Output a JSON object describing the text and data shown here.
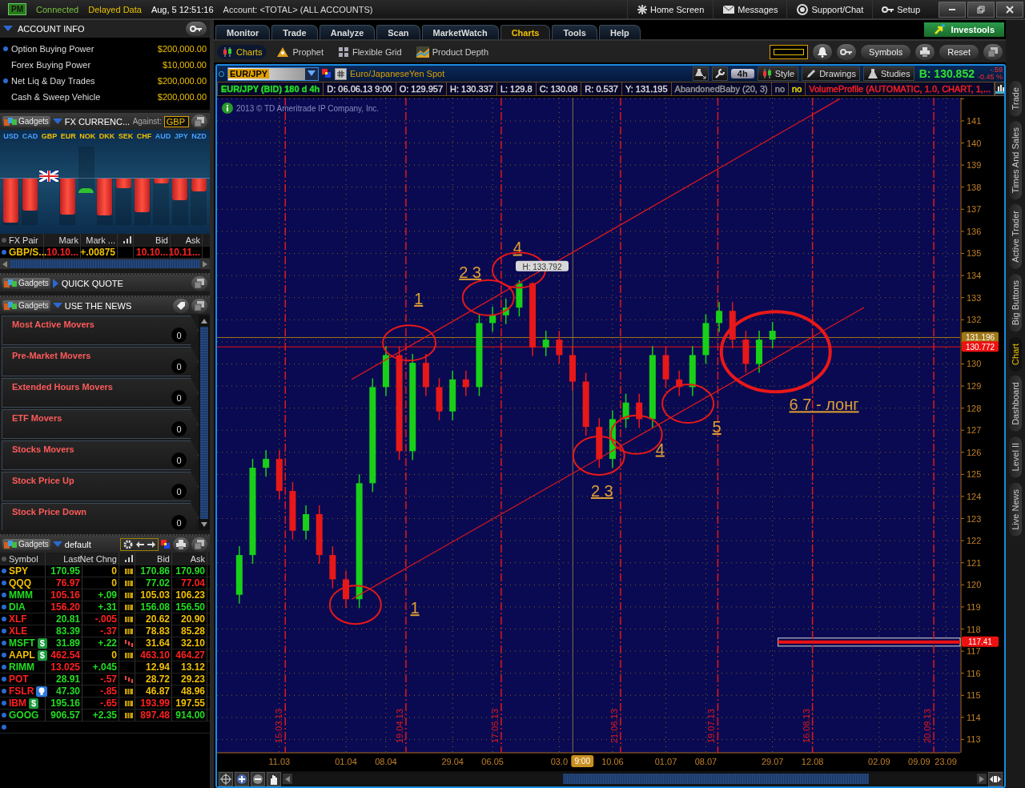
{
  "top_bar": {
    "badge": "PM",
    "status": "Connected",
    "data_mode": "Delayed Data",
    "datetime": "Aug, 5  12:51:16",
    "account": "Account: <TOTAL> (ALL ACCOUNTS)",
    "links": [
      "Home Screen",
      "Messages",
      "Support/Chat",
      "Setup"
    ]
  },
  "account_info": {
    "title": "ACCOUNT INFO",
    "rows": [
      {
        "label": "Option Buying Power",
        "value": "$200,000.00",
        "dot": true
      },
      {
        "label": "Forex Buying Power",
        "value": "$10,000.00",
        "dot": false
      },
      {
        "label": "Net Liq & Day Trades",
        "value": "$200,000.00",
        "dot": true
      },
      {
        "label": "Cash & Sweep Vehicle",
        "value": "$200,000.00",
        "dot": false
      }
    ]
  },
  "fx_gadget": {
    "gadgets": "Gadgets",
    "title": "FX CURRENC...",
    "against_label": "Against:",
    "against": "GBP",
    "currencies": [
      {
        "code": "USD",
        "color": "#4aa0ff",
        "kind": "down",
        "level": 0.95
      },
      {
        "code": "CAD",
        "color": "#4aa0ff",
        "kind": "down",
        "level": 0.69
      },
      {
        "code": "GBP",
        "color": "#f0c000",
        "kind": "flag"
      },
      {
        "code": "EUR",
        "color": "#f0c000",
        "kind": "down",
        "level": 0.78
      },
      {
        "code": "NOK",
        "color": "#f0c000",
        "kind": "up",
        "level": 0.1
      },
      {
        "code": "DKK",
        "color": "#f0c000",
        "kind": "down",
        "level": 0.79
      },
      {
        "code": "SEK",
        "color": "#f0c000",
        "kind": "down",
        "level": 0.2
      },
      {
        "code": "CHF",
        "color": "#f0c000",
        "kind": "down",
        "level": 0.72
      },
      {
        "code": "AUD",
        "color": "#4aa0ff",
        "kind": "down",
        "level": 0.1
      },
      {
        "code": "JPY",
        "color": "#4aa0ff",
        "kind": "down",
        "level": 0.47
      },
      {
        "code": "NZD",
        "color": "#4aa0ff",
        "kind": "down",
        "level": 0.28
      }
    ],
    "columns": [
      "FX Pair",
      "Mark",
      "Mark ...",
      "Bid",
      "Ask"
    ],
    "rows": [
      {
        "cells": [
          {
            "text": "GBP/S...",
            "color": "#f0c000"
          },
          {
            "text": "10.10...",
            "color": "#ff2020"
          },
          {
            "text": "+.00875",
            "color": "#f0c000"
          },
          {
            "text": "10.10...",
            "color": "#ff2020"
          },
          {
            "text": "10.11...",
            "color": "#ff2020"
          }
        ]
      }
    ]
  },
  "quick_quote": {
    "gadgets": "Gadgets",
    "title": "QUICK QUOTE",
    "expanded": false
  },
  "news": {
    "gadgets": "Gadgets",
    "title": "USE THE NEWS",
    "expanded": true,
    "items": [
      {
        "title": "Most Active Movers",
        "count": "0"
      },
      {
        "title": "Pre-Market Movers",
        "count": "0"
      },
      {
        "title": "Extended Hours Movers",
        "count": "0"
      },
      {
        "title": "ETF Movers",
        "count": "0"
      },
      {
        "title": "Stocks Movers",
        "count": "0"
      },
      {
        "title": "Stock Price Up",
        "count": "0"
      },
      {
        "title": "Stock Price Down",
        "count": "0"
      }
    ]
  },
  "watchlist": {
    "gadgets": "Gadgets",
    "name": "default",
    "columns": [
      "Symbol",
      "Last",
      "Net Chng",
      "Bid",
      "Ask"
    ],
    "rows": [
      {
        "kind": "plain",
        "signal": true,
        "falling": false,
        "cells": [
          {
            "text": "SPY",
            "color": "#f0c000"
          },
          {
            "text": "170.95",
            "color": "#22dd22"
          },
          {
            "text": "0",
            "color": "#f0c000"
          },
          {
            "text": "170.86",
            "color": "#22dd22"
          },
          {
            "text": "170.90",
            "color": "#22dd22"
          }
        ]
      },
      {
        "kind": "plain",
        "signal": true,
        "falling": false,
        "cells": [
          {
            "text": "QQQ",
            "color": "#f0c000"
          },
          {
            "text": "76.97",
            "color": "#ff2020"
          },
          {
            "text": "0",
            "color": "#f0c000"
          },
          {
            "text": "77.02",
            "color": "#22dd22"
          },
          {
            "text": "77.04",
            "color": "#ff2020"
          }
        ]
      },
      {
        "kind": "plain",
        "signal": true,
        "falling": false,
        "cells": [
          {
            "text": "MMM",
            "color": "#22dd22"
          },
          {
            "text": "105.16",
            "color": "#ff2020"
          },
          {
            "text": "+.09",
            "color": "#22dd22"
          },
          {
            "text": "105.03",
            "color": "#f0c000"
          },
          {
            "text": "106.23",
            "color": "#f0c000"
          }
        ]
      },
      {
        "kind": "plain",
        "signal": true,
        "falling": false,
        "cells": [
          {
            "text": "DIA",
            "color": "#22dd22"
          },
          {
            "text": "156.20",
            "color": "#ff2020"
          },
          {
            "text": "+.31",
            "color": "#22dd22"
          },
          {
            "text": "156.08",
            "color": "#22dd22"
          },
          {
            "text": "156.50",
            "color": "#22dd22"
          }
        ]
      },
      {
        "kind": "plain",
        "signal": true,
        "falling": false,
        "cells": [
          {
            "text": "XLF",
            "color": "#ff2020"
          },
          {
            "text": "20.81",
            "color": "#22dd22"
          },
          {
            "text": "-.005",
            "color": "#ff2020"
          },
          {
            "text": "20.62",
            "color": "#f0c000"
          },
          {
            "text": "20.90",
            "color": "#f0c000"
          }
        ]
      },
      {
        "kind": "plain",
        "signal": true,
        "falling": false,
        "cells": [
          {
            "text": "XLE",
            "color": "#ff2020"
          },
          {
            "text": "83.39",
            "color": "#22dd22"
          },
          {
            "text": "-.37",
            "color": "#ff2020"
          },
          {
            "text": "78.83",
            "color": "#f0c000"
          },
          {
            "text": "85.28",
            "color": "#f0c000"
          }
        ]
      },
      {
        "kind": "dollar",
        "badge": "$",
        "signal": true,
        "falling": true,
        "cells": [
          {
            "text": "MSFT",
            "color": "#22dd22"
          },
          {
            "text": "31.89",
            "color": "#22dd22"
          },
          {
            "text": "+.22",
            "color": "#22dd22"
          },
          {
            "text": "31.64",
            "color": "#f0c000"
          },
          {
            "text": "32.10",
            "color": "#f0c000"
          }
        ]
      },
      {
        "kind": "dollar",
        "badge": "$",
        "signal": true,
        "falling": false,
        "cells": [
          {
            "text": "AAPL",
            "color": "#f0c000"
          },
          {
            "text": "462.54",
            "color": "#ff2020"
          },
          {
            "text": "0",
            "color": "#f0c000"
          },
          {
            "text": "463.10",
            "color": "#ff2020"
          },
          {
            "text": "464.27",
            "color": "#ff2020"
          }
        ]
      },
      {
        "kind": "plain",
        "signal": false,
        "cells": [
          {
            "text": "RIMM",
            "color": "#22dd22"
          },
          {
            "text": "13.025",
            "color": "#ff2020"
          },
          {
            "text": "+.045",
            "color": "#22dd22"
          },
          {
            "text": "12.94",
            "color": "#f0c000"
          },
          {
            "text": "13.12",
            "color": "#f0c000"
          }
        ]
      },
      {
        "kind": "plain",
        "signal": true,
        "falling": true,
        "cells": [
          {
            "text": "POT",
            "color": "#ff2020"
          },
          {
            "text": "28.91",
            "color": "#22dd22"
          },
          {
            "text": "-.57",
            "color": "#ff2020"
          },
          {
            "text": "28.72",
            "color": "#f0c000"
          },
          {
            "text": "29.23",
            "color": "#f0c000"
          }
        ]
      },
      {
        "kind": "bulb",
        "signal": true,
        "falling": false,
        "cells": [
          {
            "text": "FSLR",
            "color": "#ff2020"
          },
          {
            "text": "47.30",
            "color": "#22dd22"
          },
          {
            "text": "-.85",
            "color": "#ff2020"
          },
          {
            "text": "46.87",
            "color": "#f0c000"
          },
          {
            "text": "48.96",
            "color": "#f0c000"
          }
        ]
      },
      {
        "kind": "dollar",
        "badge": "$",
        "signal": true,
        "falling": false,
        "cells": [
          {
            "text": "IBM",
            "color": "#ff2020"
          },
          {
            "text": "195.16",
            "color": "#22dd22"
          },
          {
            "text": "-.65",
            "color": "#ff2020"
          },
          {
            "text": "193.99",
            "color": "#ff2020"
          },
          {
            "text": "197.55",
            "color": "#f0c000"
          }
        ]
      },
      {
        "kind": "plain",
        "signal": true,
        "falling": false,
        "cells": [
          {
            "text": "GOOG",
            "color": "#22dd22"
          },
          {
            "text": "906.57",
            "color": "#22dd22"
          },
          {
            "text": "+2.35",
            "color": "#22dd22"
          },
          {
            "text": "897.48",
            "color": "#ff2020"
          },
          {
            "text": "914.00",
            "color": "#22dd22"
          }
        ]
      }
    ]
  },
  "main_tabs": [
    {
      "label": "Monitor",
      "selected": false
    },
    {
      "label": "Trade",
      "selected": false
    },
    {
      "label": "Analyze",
      "selected": false
    },
    {
      "label": "Scan",
      "selected": false
    },
    {
      "label": "MarketWatch",
      "selected": false
    },
    {
      "label": "Charts",
      "selected": true
    },
    {
      "label": "Tools",
      "selected": false
    },
    {
      "label": "Help",
      "selected": false
    }
  ],
  "investools": "Investools",
  "sub_tabs": [
    {
      "label": "Charts",
      "selected": true
    },
    {
      "label": "Prophet",
      "selected": false
    },
    {
      "label": "Flexible Grid",
      "selected": false
    },
    {
      "label": "Product Depth",
      "selected": false
    }
  ],
  "toolbar_buttons": [
    "Symbols",
    "Reset"
  ],
  "chart": {
    "symbol": "EUR/JPY",
    "description": "Euro/JapaneseYen Spot",
    "aggregation": "4h",
    "tools": [
      "Style",
      "Drawings",
      "Studies"
    ],
    "bid": "B: 130.852",
    "change": "-.59",
    "change_pct": "-0.45 %",
    "info": [
      {
        "text": "EUR/JPY (BID) 180 d 4h",
        "color": "#22dd22"
      },
      {
        "text": "D: 06.06.13 9:00",
        "color": "#dddddd"
      },
      {
        "text": "O: 129.957",
        "color": "#dddddd"
      },
      {
        "text": "H: 130.337",
        "color": "#dddddd"
      },
      {
        "text": "L: 129.8",
        "color": "#dddddd"
      },
      {
        "text": "C: 130.08",
        "color": "#dddddd"
      },
      {
        "text": "R: 0.537",
        "color": "#dddddd"
      },
      {
        "text": "Y: 131.195",
        "color": "#dddddd"
      },
      {
        "text": "AbandonedBaby (20, 3)",
        "color": "#999999"
      },
      {
        "text": "no",
        "color": "#999999"
      },
      {
        "text": "no",
        "color": "#f0e000"
      },
      {
        "text": "VolumeProfile (AUTOMATIC, 1.0, CHART, 1,...",
        "color": "#ff2020"
      }
    ],
    "copyright": "2013 © TD Ameritrade IP Company, Inc.",
    "chart_data": {
      "type": "candlestick",
      "grid": true,
      "ylim": [
        112.4,
        142.05
      ],
      "categories": [
        null,
        null,
        null,
        "11.03",
        null,
        null,
        null,
        null,
        "01.04",
        null,
        null,
        "08.04",
        null,
        null,
        null,
        null,
        "29.04",
        null,
        null,
        "06.05",
        null,
        null,
        null,
        null,
        "03.0",
        null,
        null,
        null,
        "10.06",
        null,
        null,
        null,
        "01.07",
        null,
        null,
        "08.07",
        null,
        null,
        null,
        null,
        "29.07",
        null,
        null,
        "12.08",
        null,
        null,
        null,
        null,
        "02.09",
        null,
        null,
        "09.09",
        null,
        "23.09",
        null
      ],
      "yticks": [
        113,
        114,
        115,
        116,
        117,
        118,
        119,
        120,
        121,
        122,
        123,
        124,
        125,
        126,
        127,
        128,
        129,
        130,
        132,
        133,
        134,
        135,
        136,
        137,
        138,
        139,
        140,
        141
      ],
      "ohlc": [
        [
          119.55,
          121.75,
          119.15,
          121.35
        ],
        [
          121.35,
          125.7,
          120.95,
          125.3
        ],
        [
          125.3,
          126.1,
          124.9,
          125.7
        ],
        [
          125.7,
          126.1,
          123.85,
          124.25
        ],
        [
          124.25,
          124.65,
          122.05,
          122.45
        ],
        [
          122.45,
          123.6,
          122.05,
          123.2
        ],
        [
          123.2,
          123.6,
          120.95,
          121.35
        ],
        [
          121.35,
          121.75,
          119.85,
          120.25
        ],
        [
          120.25,
          120.65,
          118.95,
          119.35
        ],
        [
          119.35,
          125,
          118.95,
          124.6
        ],
        [
          124.6,
          129.35,
          124.2,
          128.95
        ],
        [
          128.95,
          130.8,
          128.55,
          130.4
        ],
        [
          130.4,
          130.8,
          125.65,
          126.05
        ],
        [
          126.05,
          130.45,
          125.65,
          130.05
        ],
        [
          130.05,
          130.45,
          128.55,
          128.95
        ],
        [
          128.95,
          129.35,
          127.45,
          127.85
        ],
        [
          127.85,
          129.7,
          127.45,
          129.3
        ],
        [
          129.3,
          129.7,
          128.55,
          128.95
        ],
        [
          128.95,
          132.25,
          128.55,
          131.85
        ],
        [
          131.85,
          132.6,
          131.45,
          132.2
        ],
        [
          132.2,
          132.95,
          131.8,
          132.55
        ],
        [
          132.55,
          133.792,
          132.15,
          133.65
        ],
        [
          133.65,
          133.7,
          130.35,
          130.75
        ],
        [
          130.75,
          131.5,
          130.35,
          131.1
        ],
        [
          131.1,
          131.5,
          130,
          130.4
        ],
        [
          130.4,
          130.8,
          128.8,
          129.2
        ],
        [
          129.2,
          129.6,
          126.75,
          127.15
        ],
        [
          127.15,
          127.55,
          125.3,
          125.7
        ],
        [
          125.7,
          127.9,
          125.3,
          127.5
        ],
        [
          127.5,
          128.65,
          127.1,
          128.25
        ],
        [
          128.25,
          128.65,
          127.1,
          127.5
        ],
        [
          127.5,
          130.8,
          127.1,
          130.4
        ],
        [
          130.4,
          130.8,
          128.9,
          129.3
        ],
        [
          129.3,
          129.7,
          128.55,
          128.95
        ],
        [
          128.95,
          130.8,
          128.55,
          130.4
        ],
        [
          130.4,
          132.25,
          130,
          131.85
        ],
        [
          131.85,
          132.8,
          131.45,
          132.4
        ],
        [
          132.4,
          132.8,
          130.7,
          131.1
        ],
        [
          131.1,
          131.5,
          129.6,
          130
        ],
        [
          130,
          131.5,
          129.6,
          131.1
        ],
        [
          131.1,
          131.9,
          130.7,
          131.5
        ],
        null,
        null,
        null,
        null,
        null,
        null,
        null,
        null,
        null,
        null,
        null,
        null,
        null,
        null
      ],
      "ref_lines": [
        {
          "axis": "y",
          "value": 131.196,
          "label": "131.196",
          "color": "#a07818"
        },
        {
          "axis": "y",
          "value": 130.772,
          "label": "130.772",
          "color": "#ee1111"
        },
        {
          "axis": "y",
          "value": 117.41,
          "label": "117.41",
          "color": "#ee1111"
        }
      ],
      "annotations": [
        "1",
        "2 3",
        "4",
        "H: 133.792",
        "1",
        "2 3",
        "4",
        "5",
        "6 7 - лонг",
        "9:00",
        "15.03.13",
        "19.04.13",
        "17.05.13",
        "21.06.13",
        "19.07.13",
        "16.08.13",
        "20.09.13"
      ]
    }
  },
  "side_tabs": [
    {
      "label": "Trade",
      "selected": false
    },
    {
      "label": "Times And Sales",
      "selected": false
    },
    {
      "label": "Active Trader",
      "selected": false
    },
    {
      "label": "Big Buttons",
      "selected": false
    },
    {
      "label": "Chart",
      "selected": true
    },
    {
      "label": "Dashboard",
      "selected": false
    },
    {
      "label": "Level II",
      "selected": false
    },
    {
      "label": "Live News",
      "selected": false
    }
  ]
}
